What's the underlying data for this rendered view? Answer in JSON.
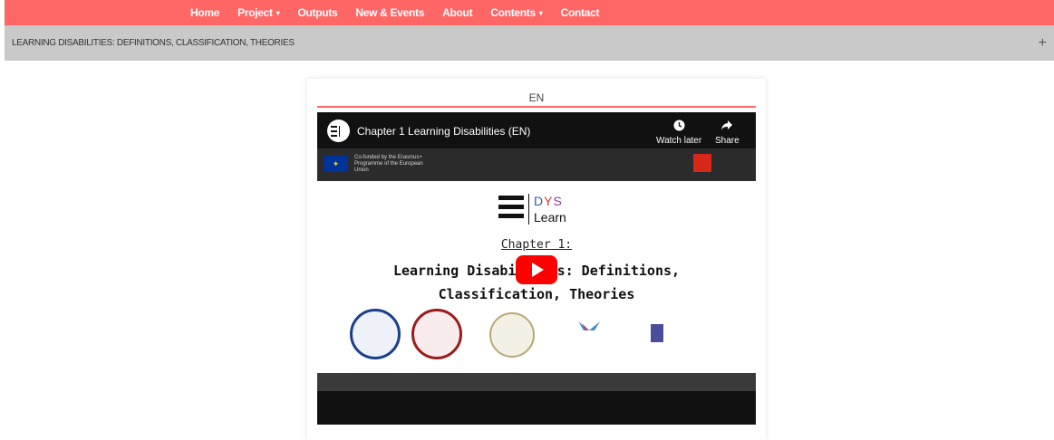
{
  "nav": {
    "items": [
      {
        "label": "Home",
        "dropdown": false
      },
      {
        "label": "Project",
        "dropdown": true
      },
      {
        "label": "Outputs",
        "dropdown": false
      },
      {
        "label": "New & Events",
        "dropdown": false
      },
      {
        "label": "About",
        "dropdown": false
      },
      {
        "label": "Contents",
        "dropdown": true
      },
      {
        "label": "Contact",
        "dropdown": false
      }
    ],
    "caret": "▾"
  },
  "section": {
    "title": "LEARNING DISABILITIES: DEFINITIONS, CLASSIFICATION, THEORIES",
    "expand_icon": "+"
  },
  "card": {
    "language": "EN"
  },
  "video": {
    "title": "Chapter 1 Learning Disabilities (EN)",
    "watch_later_label": "Watch later",
    "share_label": "Share",
    "eu_text": "Co-funded by the Erasmus+ Programme of the European Union",
    "slide": {
      "logo_text": "Learn",
      "chapter": "Chapter 1:",
      "title_line1": "Learning Disabilities: Definitions,",
      "title_line2": "Classification, Theories"
    }
  },
  "colors": {
    "accent": "#ff6666",
    "section_bar": "#c9c9c9",
    "play": "#ff0000"
  }
}
